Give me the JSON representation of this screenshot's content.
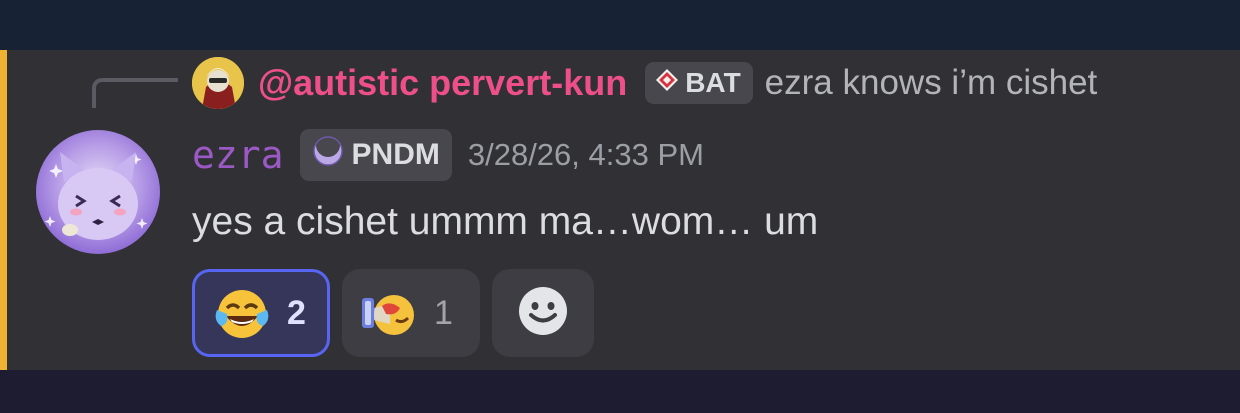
{
  "colors": {
    "mention_bar": "#f0b232",
    "reply_name": "#ee4f8b",
    "author_name": "#9b59c6",
    "reaction_selected_border": "#5865f2"
  },
  "reply": {
    "author": "@autistic pervert-kun",
    "tag_icon": "diamond-gem-icon",
    "tag": "BAT",
    "text": "ezra knows i’m cishet"
  },
  "message": {
    "author": "ezra",
    "tag_icon": "crescent-moon-icon",
    "tag": "PNDM",
    "timestamp": "3/28/26, 4:33 PM",
    "content": "yes a cishet ummm ma…wom… um"
  },
  "reactions": [
    {
      "emoji": "face-with-tears-of-joy-icon",
      "count": "2",
      "selected": true
    },
    {
      "emoji": "spraying-face-custom-emoji-icon",
      "count": "1",
      "selected": false
    }
  ],
  "add_reaction_icon": "smiley-add-reaction-icon"
}
